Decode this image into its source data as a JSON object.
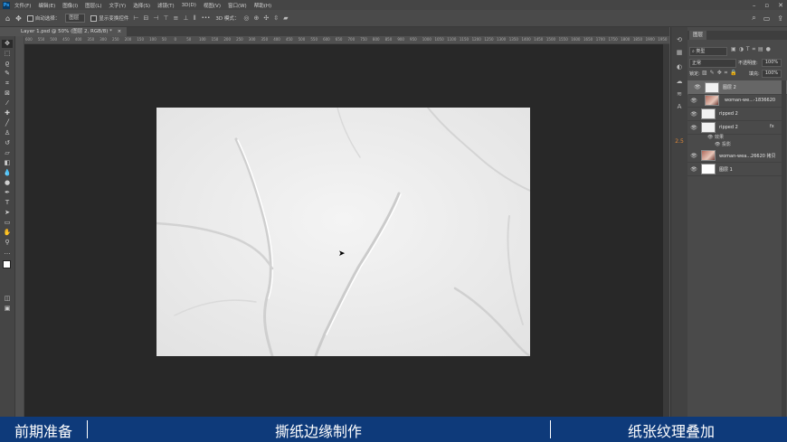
{
  "menu": {
    "items": [
      "文件(F)",
      "编辑(E)",
      "图像(I)",
      "图层(L)",
      "文字(Y)",
      "选择(S)",
      "滤镜(T)",
      "3D(D)",
      "视图(V)",
      "窗口(W)",
      "帮助(H)"
    ]
  },
  "options_bar": {
    "auto_select_label": "自动选择：",
    "auto_select_value": "图层",
    "show_transform_label": "显示变换控件",
    "more_label": "•••",
    "mode_3d_label": "3D 模式："
  },
  "document": {
    "tab_title": "Layer 1.psd @ 50% (图层 2, RGB/8) *",
    "zoom": "50%",
    "ruler_ticks": [
      "600",
      "550",
      "500",
      "450",
      "400",
      "350",
      "300",
      "250",
      "200",
      "150",
      "100",
      "50",
      "0",
      "50",
      "100",
      "150",
      "200",
      "250",
      "300",
      "350",
      "400",
      "450",
      "500",
      "550",
      "600",
      "650",
      "700",
      "750",
      "800",
      "850",
      "900",
      "950",
      "1000",
      "1050",
      "1100",
      "1150",
      "1200",
      "1250",
      "1300",
      "1350",
      "1400",
      "1450",
      "1500",
      "1550",
      "1600",
      "1650",
      "1700",
      "1750",
      "1800",
      "1850",
      "1900",
      "1950"
    ]
  },
  "layers_panel": {
    "tab_label": "图层",
    "kind_label": "类型",
    "blend_mode": "正常",
    "opacity_label": "不透明度:",
    "opacity_value": "100%",
    "lock_label": "锁定:",
    "fill_label": "填充:",
    "fill_value": "100%",
    "layers": [
      {
        "name": "图层 2",
        "visible": true,
        "selected": true,
        "thumb": "paper"
      },
      {
        "name": "woman-we...-1836620",
        "visible": true,
        "selected": false,
        "thumb": "photo"
      },
      {
        "name": "ripped 2",
        "visible": true,
        "selected": false,
        "thumb": "paper"
      },
      {
        "name": "ripped 2",
        "visible": true,
        "selected": false,
        "thumb": "paper",
        "fx": "fx"
      },
      {
        "name": "woman-wea...26620 拷贝",
        "visible": true,
        "selected": false,
        "thumb": "photo"
      },
      {
        "name": "图层 1",
        "visible": true,
        "selected": false,
        "thumb": "white"
      }
    ],
    "effects": [
      "效果",
      "投影"
    ]
  },
  "banner": {
    "left": "前期准备",
    "middle": "撕纸边缘制作",
    "right": "纸张纹理叠加",
    "color": "#0e3a7a"
  }
}
